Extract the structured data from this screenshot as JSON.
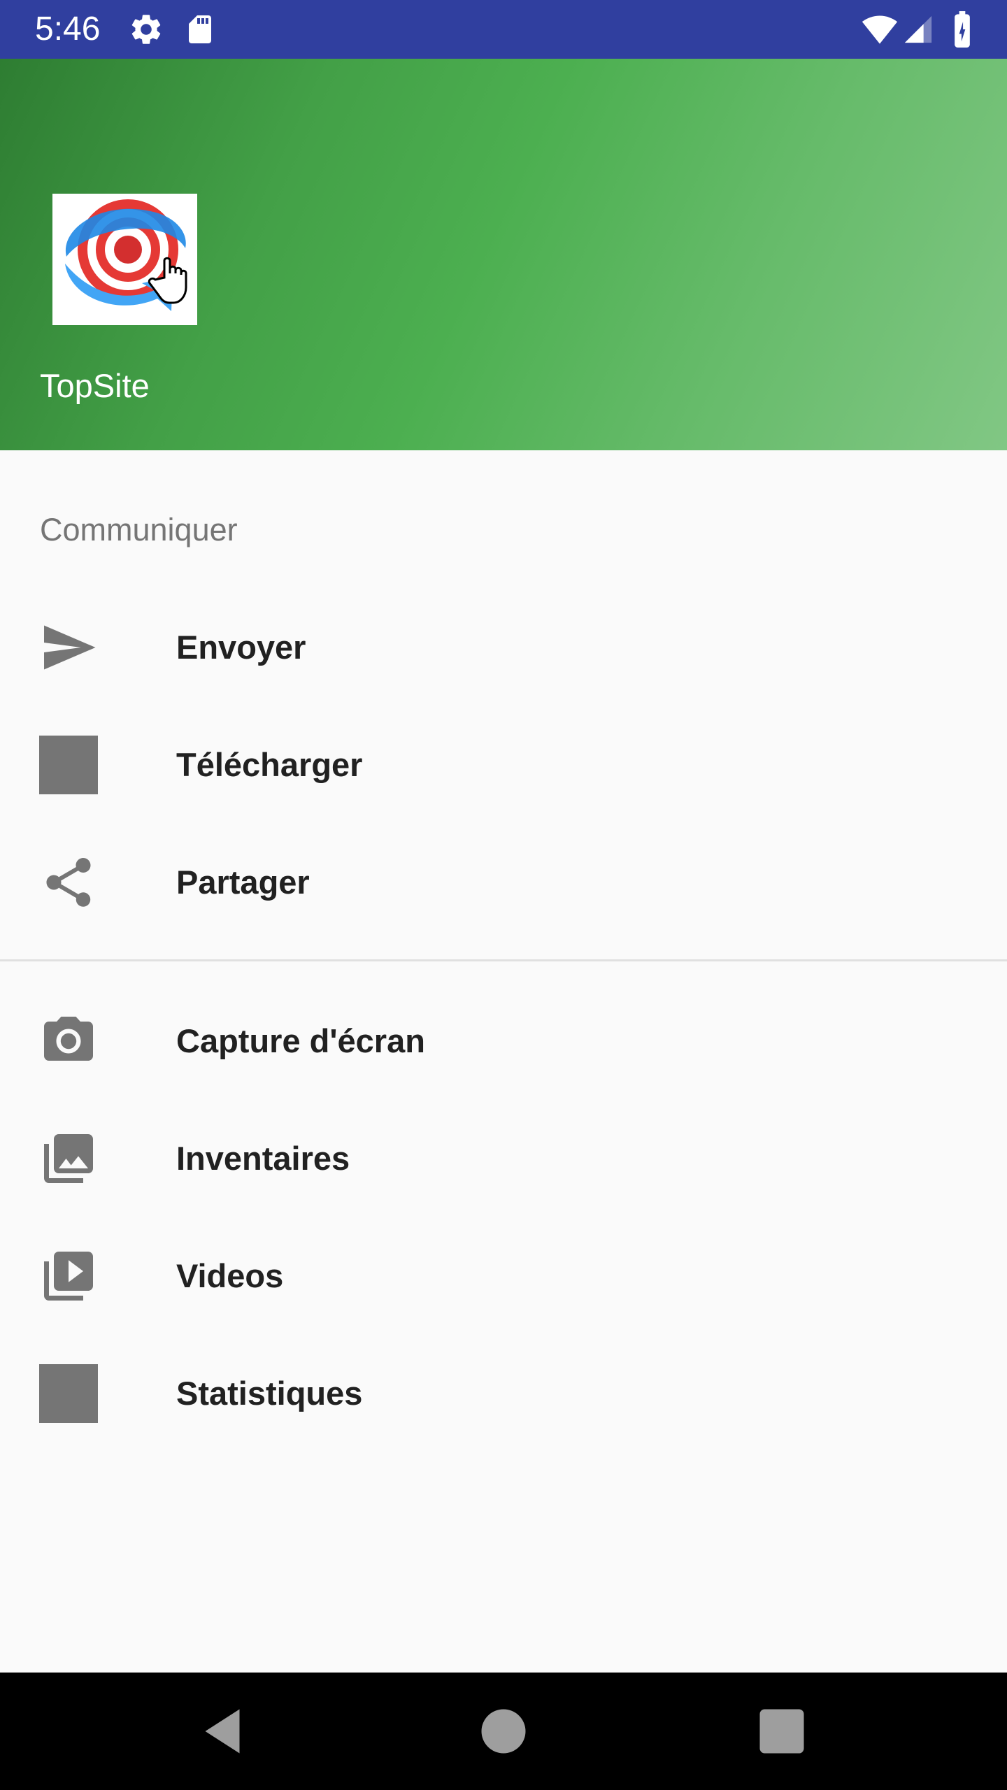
{
  "status_bar": {
    "time": "5:46",
    "icons": [
      "settings-icon",
      "sd-card-icon",
      "wifi-icon",
      "signal-icon",
      "battery-charging-icon"
    ],
    "color": "#303f9f"
  },
  "header": {
    "app_name": "TopSite",
    "logo": "topsite-logo",
    "gradient_colors": [
      "#2e7d32",
      "#4caf50",
      "#81c784"
    ]
  },
  "menu": {
    "section_title": "Communiquer",
    "group1": [
      {
        "label": "Envoyer",
        "icon": "send-icon"
      },
      {
        "label": "Télécharger",
        "icon": "placeholder-square-icon"
      },
      {
        "label": "Partager",
        "icon": "share-icon"
      }
    ],
    "group2": [
      {
        "label": "Capture d'écran",
        "icon": "camera-icon"
      },
      {
        "label": "Inventaires",
        "icon": "photo-library-icon"
      },
      {
        "label": "Videos",
        "icon": "video-library-icon"
      },
      {
        "label": "Statistiques",
        "icon": "placeholder-square-icon"
      }
    ],
    "icon_color": "#757575"
  },
  "nav_bar": {
    "buttons": [
      "back-icon",
      "home-icon",
      "recents-icon"
    ]
  }
}
